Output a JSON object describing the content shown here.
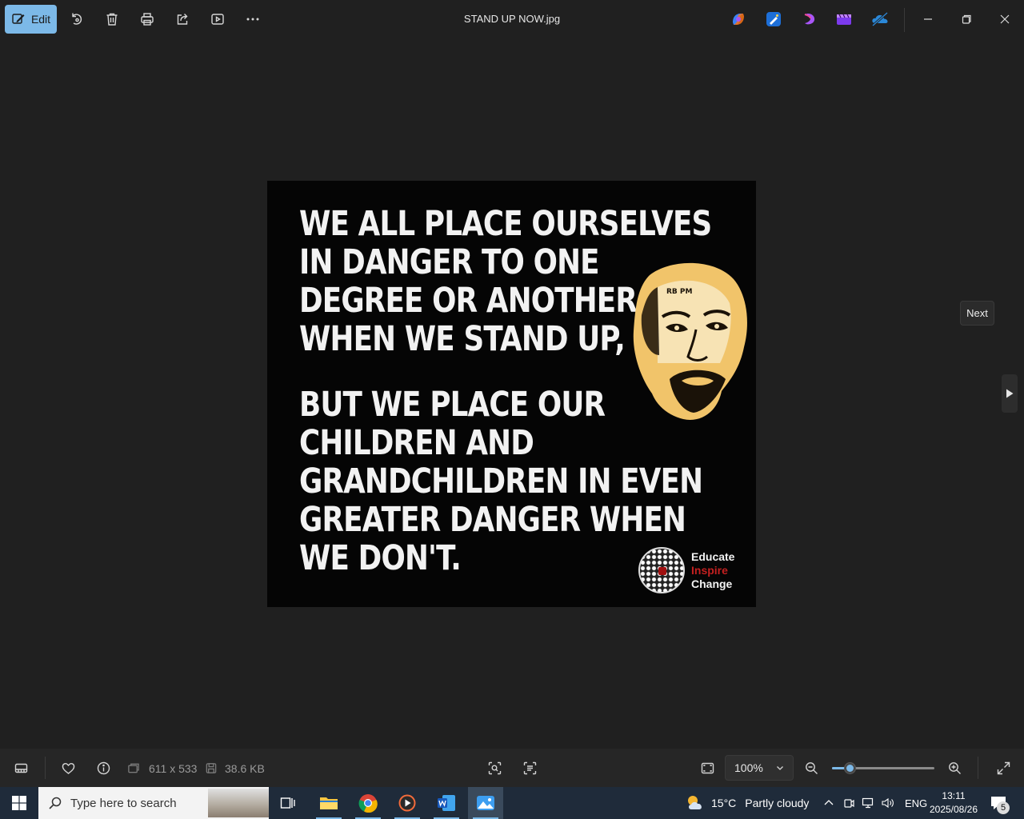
{
  "window": {
    "title": "STAND UP NOW.jpg",
    "edit_label": "Edit"
  },
  "image": {
    "quote_part1": "WE ALL PLACE OURSELVES\nIN DANGER TO ONE\nDEGREE OR ANOTHER\nWHEN WE STAND UP,",
    "quote_part2": "BUT WE PLACE OUR\nCHILDREN AND\nGRANDCHILDREN IN EVEN\nGREATER DANGER WHEN\nWE DON'T.",
    "face_tag": "RB PM",
    "brand_line1": "Educate",
    "brand_line2": "Inspire",
    "brand_line3": "Change"
  },
  "navigation": {
    "next_tooltip": "Next"
  },
  "bottombar": {
    "dimensions": "611 x 533",
    "file_size": "38.6 KB",
    "zoom_level": "100%",
    "zoom_slider_fraction": 0.17
  },
  "taskbar": {
    "search_placeholder": "Type here to search",
    "weather_temp": "15°C",
    "weather_desc": "Partly cloudy",
    "language": "ENG",
    "time": "13:11",
    "date": "2025/08/26",
    "notification_count": "5"
  },
  "colors": {
    "accent": "#7cb9e8",
    "background": "#202020",
    "taskbar": "#1f2b3a"
  }
}
